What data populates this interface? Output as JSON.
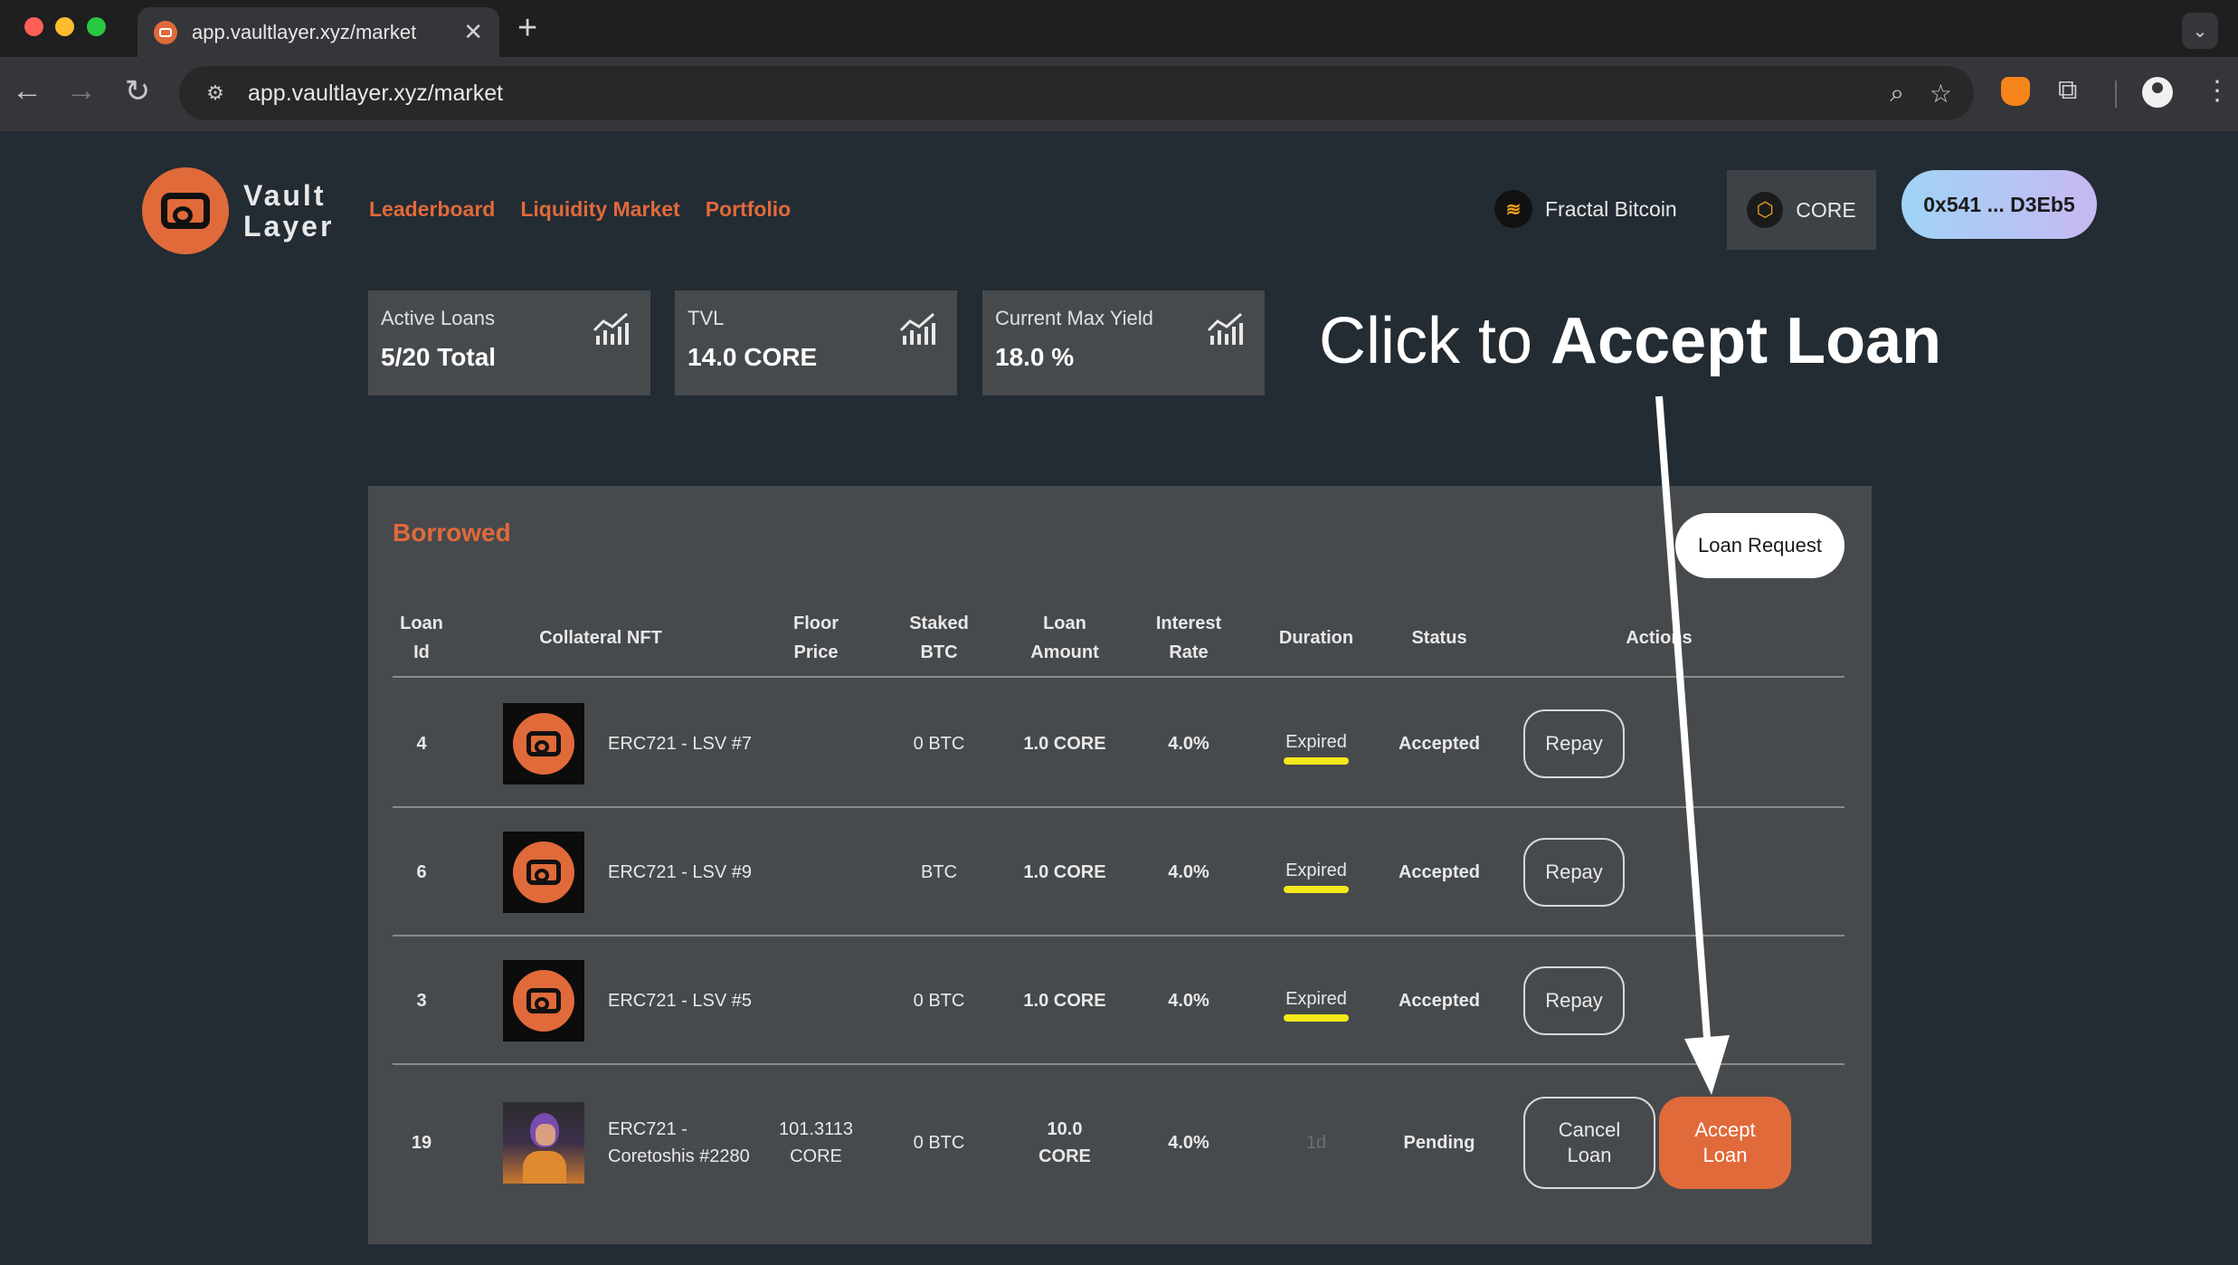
{
  "browser": {
    "tab_title": "app.vaultlayer.xyz/market",
    "url": "app.vaultlayer.xyz/market"
  },
  "header": {
    "logo_line1": "Vault",
    "logo_line2": "Layer",
    "nav": [
      "Leaderboard",
      "Liquidity Market",
      "Portfolio"
    ],
    "chain_label": "Fractal Bitcoin",
    "network_label": "CORE",
    "wallet_label": "0x541 ... D3Eb5"
  },
  "stats": [
    {
      "label": "Active Loans",
      "value": "5/20 Total"
    },
    {
      "label": "TVL",
      "value": "14.0 CORE"
    },
    {
      "label": "Current Max Yield",
      "value": "18.0 %"
    }
  ],
  "annotation": {
    "prefix": "Click to ",
    "emphasis": "Accept Loan"
  },
  "panel": {
    "title": "Borrowed",
    "loan_request_label": "Loan Request",
    "columns": {
      "loan_id": [
        "Loan",
        "Id"
      ],
      "collateral": "Collateral NFT",
      "floor": [
        "Floor",
        "Price"
      ],
      "staked": [
        "Staked",
        "BTC"
      ],
      "amount": [
        "Loan",
        "Amount"
      ],
      "rate": [
        "Interest",
        "Rate"
      ],
      "duration": "Duration",
      "status": "Status",
      "actions": "Actions"
    },
    "rows": [
      {
        "id": "4",
        "nft": "ERC721 - LSV #7",
        "floor": "",
        "staked": "0 BTC",
        "amount": "1.0 CORE",
        "rate": "4.0%",
        "duration": "Expired",
        "status": "Accepted",
        "action": "Repay"
      },
      {
        "id": "6",
        "nft": "ERC721 - LSV #9",
        "floor": "",
        "staked": "BTC",
        "amount": "1.0 CORE",
        "rate": "4.0%",
        "duration": "Expired",
        "status": "Accepted",
        "action": "Repay"
      },
      {
        "id": "3",
        "nft": "ERC721 - LSV #5",
        "floor": "",
        "staked": "0 BTC",
        "amount": "1.0 CORE",
        "rate": "4.0%",
        "duration": "Expired",
        "status": "Accepted",
        "action": "Repay"
      },
      {
        "id": "19",
        "nft_line1": "ERC721 -",
        "nft_line2": "Coretoshis #2280",
        "floor_line1": "101.3113",
        "floor_line2": "CORE",
        "staked": "0 BTC",
        "amount_line1": "10.0",
        "amount_line2": "CORE",
        "rate": "4.0%",
        "duration": "1d",
        "status": "Pending",
        "cancel_line1": "Cancel",
        "cancel_line2": "Loan",
        "accept_line1": "Accept",
        "accept_line2": "Loan"
      }
    ]
  },
  "colors": {
    "accent": "#e06a3a",
    "background": "#232b33",
    "panel": "#474a4d",
    "highlight": "#f4e81a"
  }
}
